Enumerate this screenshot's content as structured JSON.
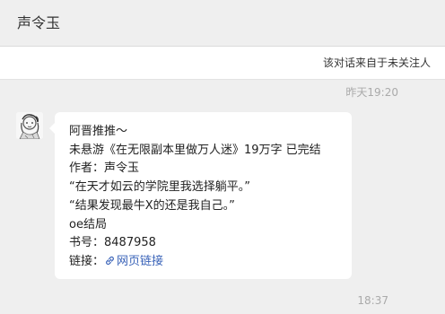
{
  "header": {
    "title": "声令玉"
  },
  "notice": {
    "text": "该对话来自于未关注人"
  },
  "chat": {
    "timestamps": [
      "昨天19:20",
      "18:37"
    ],
    "message": {
      "lines": [
        "阿晋推推～",
        "未悬游《在无限副本里做万人迷》19万字 已完结",
        "作者：声令玉",
        "“在天才如云的学院里我选择躺平。”",
        "“结果发现最牛X的还是我自己。”",
        "oe结局",
        "书号：8487958"
      ],
      "link_prefix": "链接：",
      "link_label": "网页链接"
    }
  },
  "colors": {
    "background": "#efefef",
    "bubble": "#ffffff",
    "link": "#3a63b8",
    "timestamp": "#aaaaaa"
  },
  "icons": {
    "avatar": "sketch-portrait-avatar",
    "link": "link-chain-icon"
  }
}
